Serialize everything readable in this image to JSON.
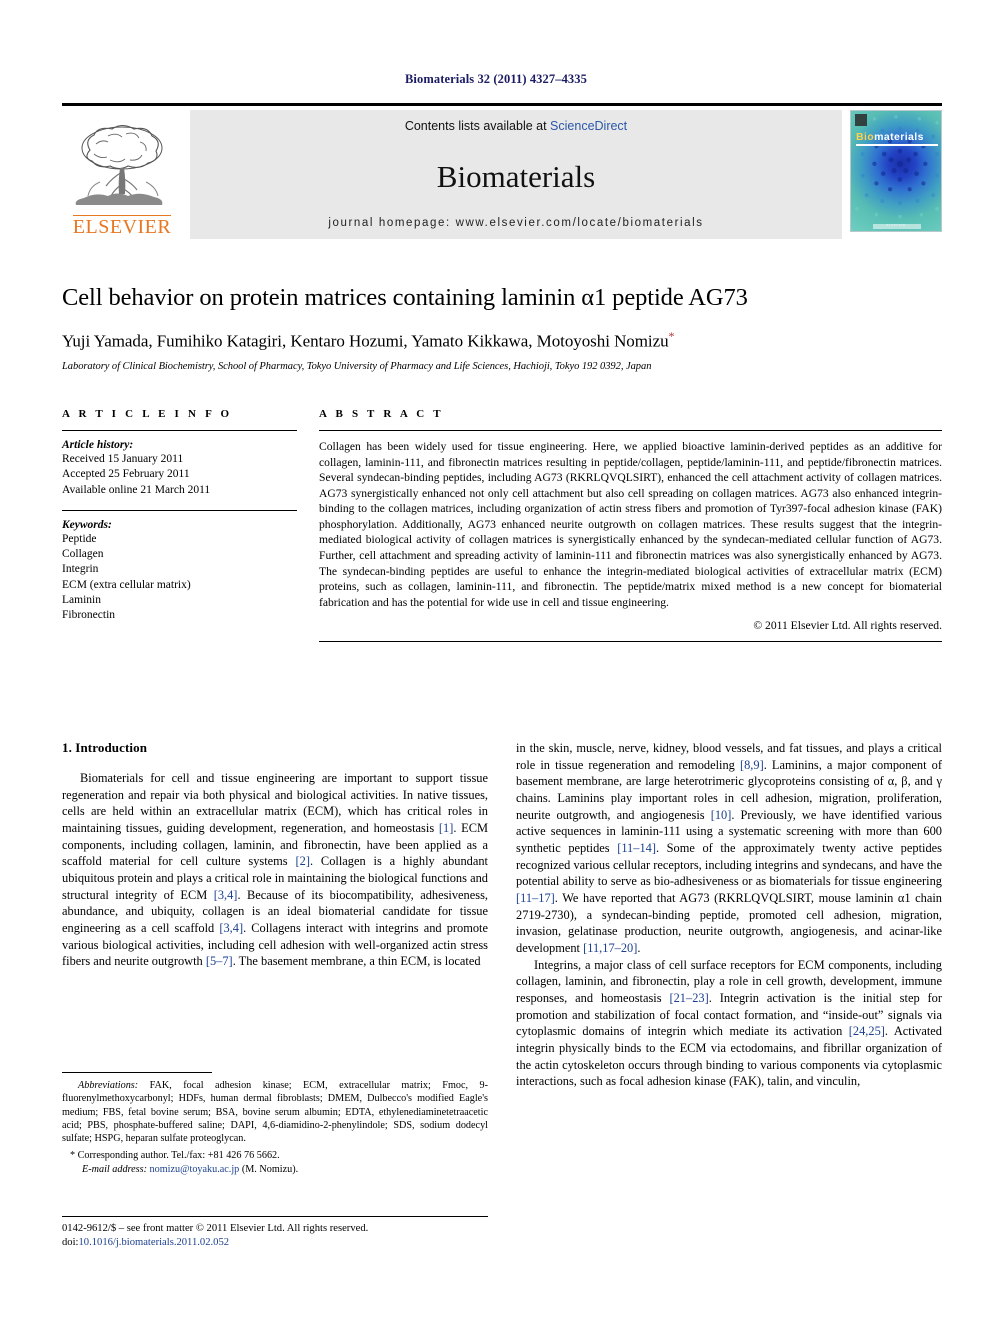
{
  "running_head": "Biomaterials 32 (2011) 4327–4335",
  "masthead": {
    "publisher_name": "ELSEVIER",
    "contents_prefix": "Contents lists available at ",
    "contents_link": "ScienceDirect",
    "journal_name": "Biomaterials",
    "homepage": "journal homepage: www.elsevier.com/locate/biomaterials",
    "cover": {
      "title_part1": "Bio",
      "title_part2": "materials",
      "footer_text": "ELSEVIER"
    },
    "accent_orange": "#E87722",
    "link_blue": "#2a57a8"
  },
  "title_block": {
    "title": "Cell behavior on protein matrices containing laminin α1 peptide AG73",
    "authors": "Yuji Yamada, Fumihiko Katagiri, Kentaro Hozumi, Yamato Kikkawa, Motoyoshi Nomizu",
    "corresponding_marker": "*",
    "affiliation": "Laboratory of Clinical Biochemistry, School of Pharmacy, Tokyo University of Pharmacy and Life Sciences, Hachioji, Tokyo 192 0392, Japan"
  },
  "article_info": {
    "heading": "A R T I C L E  I N F O",
    "history_label": "Article history:",
    "history": [
      "Received 15 January 2011",
      "Accepted 25 February 2011",
      "Available online 21 March 2011"
    ],
    "keywords_label": "Keywords:",
    "keywords": [
      "Peptide",
      "Collagen",
      "Integrin",
      "ECM (extra cellular matrix)",
      "Laminin",
      "Fibronectin"
    ]
  },
  "abstract": {
    "heading": "A B S T R A C T",
    "body": "Collagen has been widely used for tissue engineering. Here, we applied bioactive laminin-derived peptides as an additive for collagen, laminin-111, and fibronectin matrices resulting in peptide/collagen, peptide/laminin-111, and peptide/fibronectin matrices. Several syndecan-binding peptides, including AG73 (RKRLQVQLSIRT), enhanced the cell attachment activity of collagen matrices. AG73 synergistically enhanced not only cell attachment but also cell spreading on collagen matrices. AG73 also enhanced integrin-binding to the collagen matrices, including organization of actin stress fibers and promotion of Tyr397-focal adhesion kinase (FAK) phosphorylation. Additionally, AG73 enhanced neurite outgrowth on collagen matrices. These results suggest that the integrin-mediated biological activity of collagen matrices is synergistically enhanced by the syndecan-mediated cellular function of AG73. Further, cell attachment and spreading activity of laminin-111 and fibronectin matrices was also synergistically enhanced by AG73. The syndecan-binding peptides are useful to enhance the integrin-mediated biological activities of extracellular matrix (ECM) proteins, such as collagen, laminin-111, and fibronectin. The peptide/matrix mixed method is a new concept for biomaterial fabrication and has the potential for wide use in cell and tissue engineering.",
    "copyright": "© 2011 Elsevier Ltd. All rights reserved."
  },
  "introduction": {
    "heading": "1.  Introduction",
    "left_paragraph_1_a": "Biomaterials for cell and tissue engineering are important to support tissue regeneration and repair via both physical and biological activities. In native tissues, cells are held within an extracellular matrix (ECM), which has critical roles in maintaining tissues, guiding development, regeneration, and homeostasis ",
    "ref_1": "[1]",
    "left_paragraph_1_b": ". ECM components, including collagen, laminin, and fibronectin, have been applied as a scaffold material for cell culture systems ",
    "ref_2": "[2]",
    "left_paragraph_1_c": ". Collagen is a highly abundant ubiquitous protein and plays a critical role in maintaining the biological functions and structural integrity of ECM ",
    "ref_34a": "[3,4]",
    "left_paragraph_1_d": ". Because of its biocompatibility, adhesiveness, abundance, and ubiquity, collagen is an ideal biomaterial candidate for tissue engineering as a cell scaffold ",
    "ref_34b": "[3,4]",
    "left_paragraph_1_e": ". Collagens interact with integrins and promote various biological activities, including cell adhesion with well-organized actin stress fibers and neurite outgrowth ",
    "ref_57": "[5–7]",
    "left_paragraph_1_f": ". The basement membrane, a thin ECM, is located",
    "right_paragraph_1_a": "in the skin, muscle, nerve, kidney, blood vessels, and fat tissues, and plays a critical role in tissue regeneration and remodeling ",
    "ref_89": "[8,9]",
    "right_paragraph_1_b": ". Laminins, a major component of basement membrane, are large heterotrimeric glycoproteins consisting of α, β, and γ chains. Laminins play important roles in cell adhesion, migration, proliferation, neurite outgrowth, and angiogenesis ",
    "ref_10": "[10]",
    "right_paragraph_1_c": ". Previously, we have identified various active sequences in laminin-111 using a systematic screening with more than 600 synthetic peptides ",
    "ref_1114": "[11–14]",
    "right_paragraph_1_d": ". Some of the approximately twenty active peptides recognized various cellular receptors, including integrins and syndecans, and have the potential ability to serve as bio-adhesiveness or as biomaterials for tissue engineering ",
    "ref_1117": "[11–17]",
    "right_paragraph_1_e": ". We have reported that AG73 (RKRLQVQLSIRT, mouse laminin α1 chain 2719-2730), a syndecan-binding peptide, promoted cell adhesion, migration, invasion, gelatinase production, neurite outgrowth, angiogenesis, and acinar-like development ",
    "ref_111720": "[11,17–20]",
    "right_paragraph_1_f": ".",
    "right_paragraph_2_a": "Integrins, a major class of cell surface receptors for ECM components, including collagen, laminin, and fibronectin, play a role in cell growth, development, immune responses, and homeostasis ",
    "ref_2123": "[21–23]",
    "right_paragraph_2_b": ". Integrin activation is the initial step for promotion and stabilization of focal contact formation, and “inside-out” signals via cytoplasmic domains of integrin which mediate its activation ",
    "ref_2425": "[24,25]",
    "right_paragraph_2_c": ". Activated integrin physically binds to the ECM via ectodomains, and fibrillar organization of the actin cytoskeleton occurs through binding to various components via cytoplasmic interactions, such as focal adhesion kinase (FAK), talin, and vinculin,"
  },
  "footnotes": {
    "abbreviations_label": "Abbreviations:",
    "abbreviations_text": " FAK, focal adhesion kinase; ECM, extracellular matrix; Fmoc, 9-fluorenylmethoxycarbonyl; HDFs, human dermal fibroblasts; DMEM, Dulbecco's modified Eagle's medium; FBS, fetal bovine serum; BSA, bovine serum albumin; EDTA, ethylenediaminetetraacetic acid; PBS, phosphate-buffered saline; DAPI, 4,6-diamidino-2-phenylindole; SDS, sodium dodecyl sulfate; HSPG, heparan sulfate proteoglycan.",
    "corresponding": "* Corresponding author. Tel./fax: +81 426 76 5662.",
    "email_label": "E-mail address:",
    "email_link": "nomizu@toyaku.ac.jp",
    "email_suffix": " (M. Nomizu)."
  },
  "page_footer": {
    "line1": "0142-9612/$ – see front matter © 2011 Elsevier Ltd. All rights reserved.",
    "doi_label": "doi:",
    "doi_value": "10.1016/j.biomaterials.2011.02.052"
  }
}
